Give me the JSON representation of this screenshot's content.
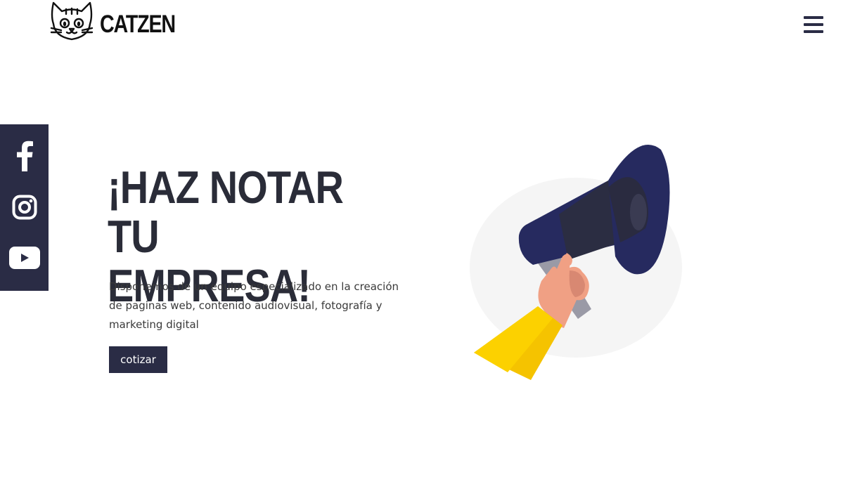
{
  "header": {
    "brand_name": "CATZEN",
    "logo_icon": "cat-face-icon",
    "menu_icon": "hamburger-menu-icon"
  },
  "social": {
    "items": [
      {
        "name": "Facebook",
        "icon": "facebook-icon"
      },
      {
        "name": "Instagram",
        "icon": "instagram-icon"
      },
      {
        "name": "YouTube",
        "icon": "youtube-icon"
      }
    ]
  },
  "hero": {
    "title_line1": "¡HAZ NOTAR TU",
    "title_line2": "EMPRESA!",
    "description": "Disponemos de un equipo especializado en la creación de paginas web, contenido audiovisual, fotografía y marketing digital",
    "cta_label": "cotizar",
    "illustration": "megaphone-hand-illustration"
  },
  "colors": {
    "primary_dark": "#2a2c45",
    "megaphone_navy": "#262a5f",
    "sleeve_yellow": "#fcd100",
    "skin": "#f0a084",
    "background_circle": "#f5f5f5"
  }
}
